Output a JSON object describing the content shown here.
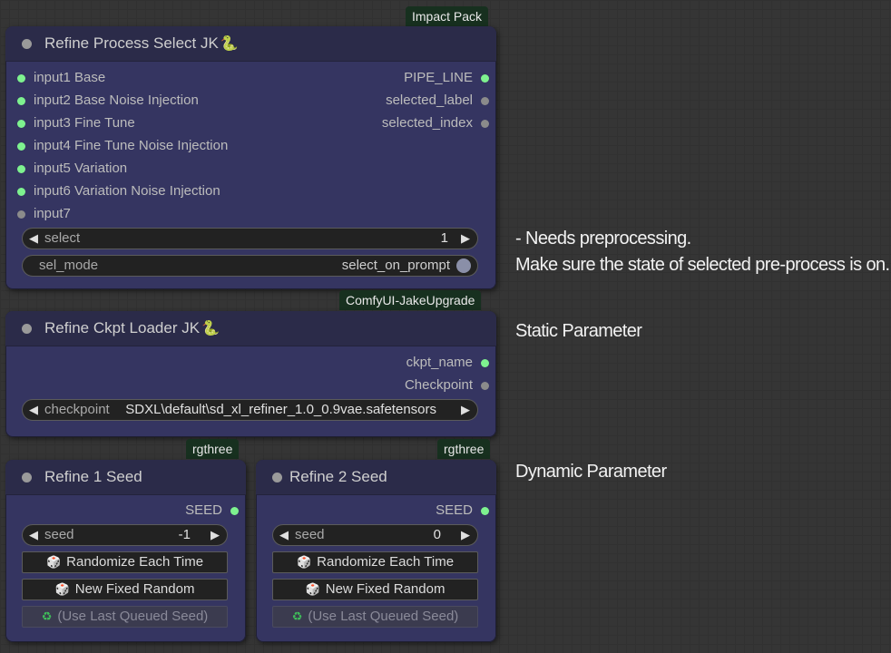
{
  "notes": {
    "preprocess_line1": "- Needs preprocessing.",
    "preprocess_line2": "Make sure the state of selected pre-process is on.",
    "static": "Static Parameter",
    "dynamic": "Dynamic Parameter"
  },
  "nodes": {
    "refine_process_select": {
      "badge": "Impact Pack",
      "title": "Refine Process Select JK",
      "title_icon": "snake-icon",
      "inputs": [
        {
          "label": "input1 Base",
          "connected": true
        },
        {
          "label": "input2 Base Noise Injection",
          "connected": true
        },
        {
          "label": "input3 Fine Tune",
          "connected": true
        },
        {
          "label": "input4 Fine Tune Noise Injection",
          "connected": true
        },
        {
          "label": "input5 Variation",
          "connected": true
        },
        {
          "label": "input6 Variation Noise Injection",
          "connected": true
        },
        {
          "label": "input7",
          "connected": false
        }
      ],
      "outputs": [
        {
          "label": "PIPE_LINE",
          "connected": true
        },
        {
          "label": "selected_label",
          "connected": false
        },
        {
          "label": "selected_index",
          "connected": false
        }
      ],
      "select_widget": {
        "label": "select",
        "value": "1"
      },
      "sel_mode_widget": {
        "label": "sel_mode",
        "value": "select_on_prompt"
      }
    },
    "refine_ckpt_loader": {
      "badge": "ComfyUI-JakeUpgrade",
      "title": "Refine Ckpt Loader JK",
      "title_icon": "snake-icon",
      "outputs": [
        {
          "label": "ckpt_name",
          "connected": true
        },
        {
          "label": "Checkpoint",
          "connected": false
        }
      ],
      "checkpoint_widget": {
        "label": "checkpoint",
        "value": "SDXL\\default\\sd_xl_refiner_1.0_0.9vae.safetensors"
      }
    },
    "refine_1_seed": {
      "badge": "rgthree",
      "title": "Refine 1 Seed",
      "output": {
        "label": "SEED",
        "connected": true
      },
      "seed_widget": {
        "label": "seed",
        "value": "-1"
      },
      "buttons": {
        "randomize": "Randomize Each Time",
        "new_fixed": "New Fixed Random",
        "use_last": "(Use Last Queued Seed)"
      }
    },
    "refine_2_seed": {
      "badge": "rgthree",
      "title": "Refine 2 Seed",
      "output": {
        "label": "SEED",
        "connected": true
      },
      "seed_widget": {
        "label": "seed",
        "value": "0"
      },
      "buttons": {
        "randomize": "Randomize Each Time",
        "new_fixed": "New Fixed Random",
        "use_last": "(Use Last Queued Seed)"
      }
    }
  },
  "colors": {
    "canvas": "#353535",
    "node_body": "#353561",
    "node_title": "#2b2b49",
    "badge": "#17301f",
    "slot_connected": "#7ef28f",
    "slot_unconnected": "#8b8b8b"
  }
}
